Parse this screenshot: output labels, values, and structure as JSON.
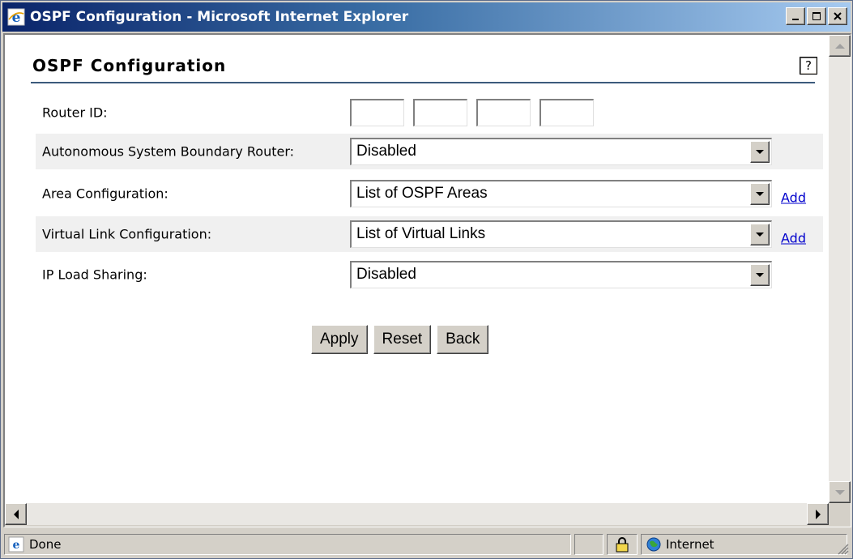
{
  "window": {
    "title": "OSPF Configuration - Microsoft Internet Explorer",
    "minimize": "_",
    "maximize": "□",
    "close": "x"
  },
  "page": {
    "heading": "OSPF Configuration",
    "help_icon": "?",
    "fields": {
      "router_id": {
        "label": "Router ID:",
        "octets": [
          "",
          "",
          "",
          ""
        ]
      },
      "asbr": {
        "label": "Autonomous System Boundary Router:",
        "value": "Disabled"
      },
      "area": {
        "label": "Area Configuration:",
        "value": "List of OSPF Areas",
        "link": "Add"
      },
      "virtual_link": {
        "label": "Virtual Link Configuration:",
        "value": "List of Virtual Links",
        "link": "Add"
      },
      "load_sharing": {
        "label": "IP Load Sharing:",
        "value": "Disabled"
      }
    },
    "buttons": {
      "apply": "Apply",
      "reset": "Reset",
      "back": "Back"
    }
  },
  "status": {
    "text": "Done",
    "zone": "Internet",
    "icons": [
      "ie-page-icon",
      "lock-icon",
      "globe-icon"
    ]
  },
  "colors": {
    "title_gradient_start": "#0a246a",
    "title_gradient_end": "#a6caf0",
    "link": "#0000cc",
    "heading_rule": "#3c5a7c",
    "row_shade": "#f0f0f0",
    "chrome": "#d4d0c8"
  }
}
